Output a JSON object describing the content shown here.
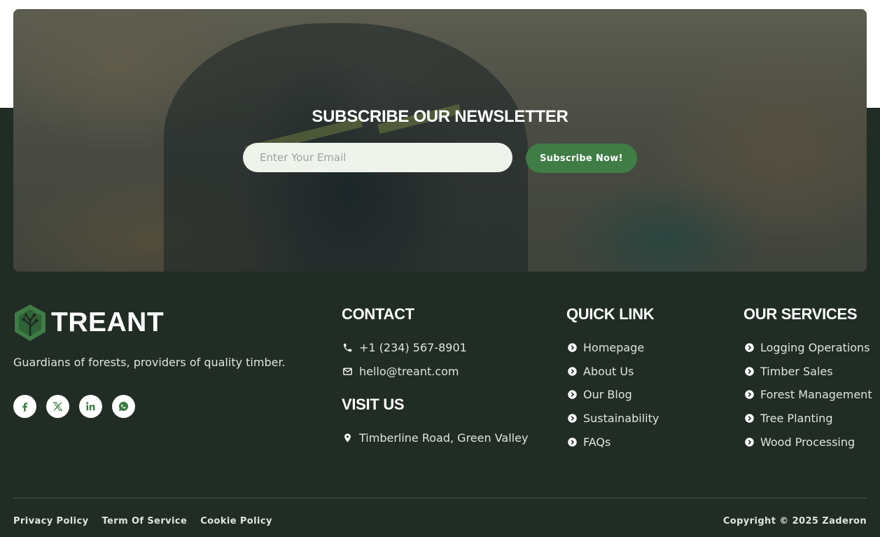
{
  "newsletter": {
    "title": "SUBSCRIBE OUR NEWSLETTER",
    "email_placeholder": "Enter Your Email",
    "button_label": "Subscribe Now!"
  },
  "brand": {
    "name": "TREANT",
    "tagline": "Guardians of forests, providers of quality timber.",
    "logo_icon": "tree-logo-icon",
    "accent_color": "#3f7c46"
  },
  "socials": [
    {
      "name": "facebook-icon"
    },
    {
      "name": "x-twitter-icon"
    },
    {
      "name": "linkedin-icon"
    },
    {
      "name": "whatsapp-icon"
    }
  ],
  "contact": {
    "title": "CONTACT",
    "phone": "+1 (234) 567-8901",
    "email": "hello@treant.com"
  },
  "visit": {
    "title": "VISIT US",
    "address": "Timberline Road, Green Valley"
  },
  "quick_link": {
    "title": "QUICK LINK",
    "items": [
      "Homepage",
      "About Us",
      "Our Blog",
      "Sustainability",
      "FAQs"
    ]
  },
  "services": {
    "title": "OUR SERVICES",
    "items": [
      "Logging Operations",
      "Timber Sales",
      "Forest Management",
      "Tree Planting",
      "Wood Processing"
    ]
  },
  "legal": {
    "privacy": "Privacy Policy",
    "terms": "Term Of Service",
    "cookie": "Cookie Policy",
    "copyright": "Copyright © 2025 Zaderon"
  },
  "colors": {
    "footer_bg": "#202c24",
    "button_green": "#3f7c46",
    "input_bg": "#eef3ec"
  }
}
